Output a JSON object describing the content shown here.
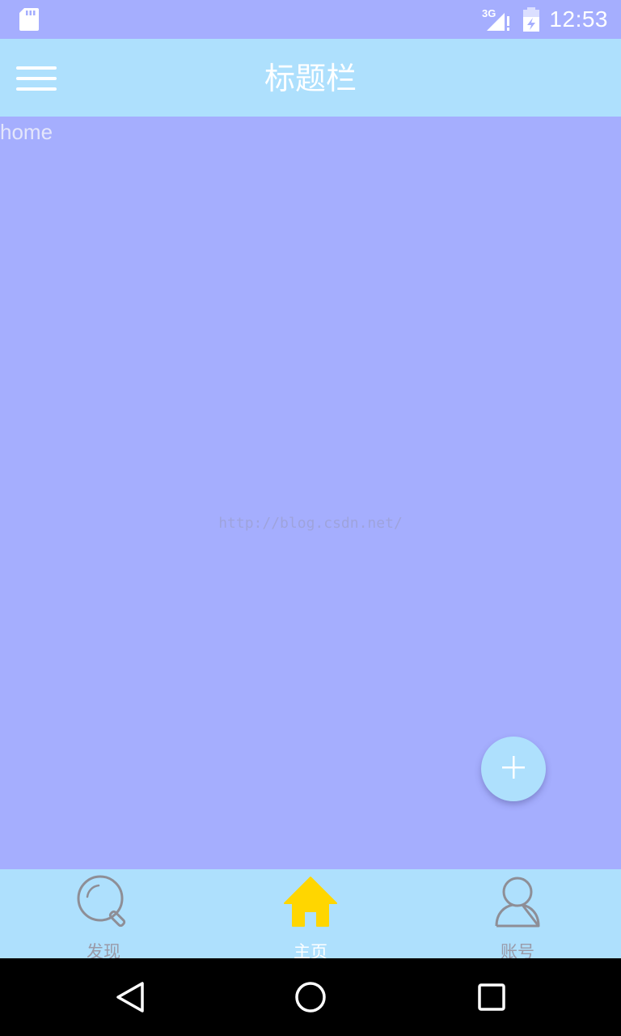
{
  "status_bar": {
    "time": "12:53",
    "network": "3G",
    "icons": [
      "sd-card-icon",
      "signal-icon",
      "battery-icon"
    ]
  },
  "app_bar": {
    "title": "标题栏",
    "menu_icon": "hamburger-menu-icon"
  },
  "content": {
    "text": "home",
    "watermark": "http://blog.csdn.net/"
  },
  "fab": {
    "icon": "plus-icon"
  },
  "bottom_nav": {
    "items": [
      {
        "label": "发现",
        "icon": "search-icon",
        "active": false
      },
      {
        "label": "主页",
        "icon": "home-icon",
        "active": true
      },
      {
        "label": "账号",
        "icon": "person-icon",
        "active": false
      }
    ]
  },
  "system_nav": {
    "buttons": [
      "back-icon",
      "home-circle-icon",
      "recents-icon"
    ]
  },
  "colors": {
    "background": "#a5aefe",
    "app_bar": "#aee0fd",
    "active_icon": "#ffd600",
    "inactive_icon": "#8e8e96"
  }
}
